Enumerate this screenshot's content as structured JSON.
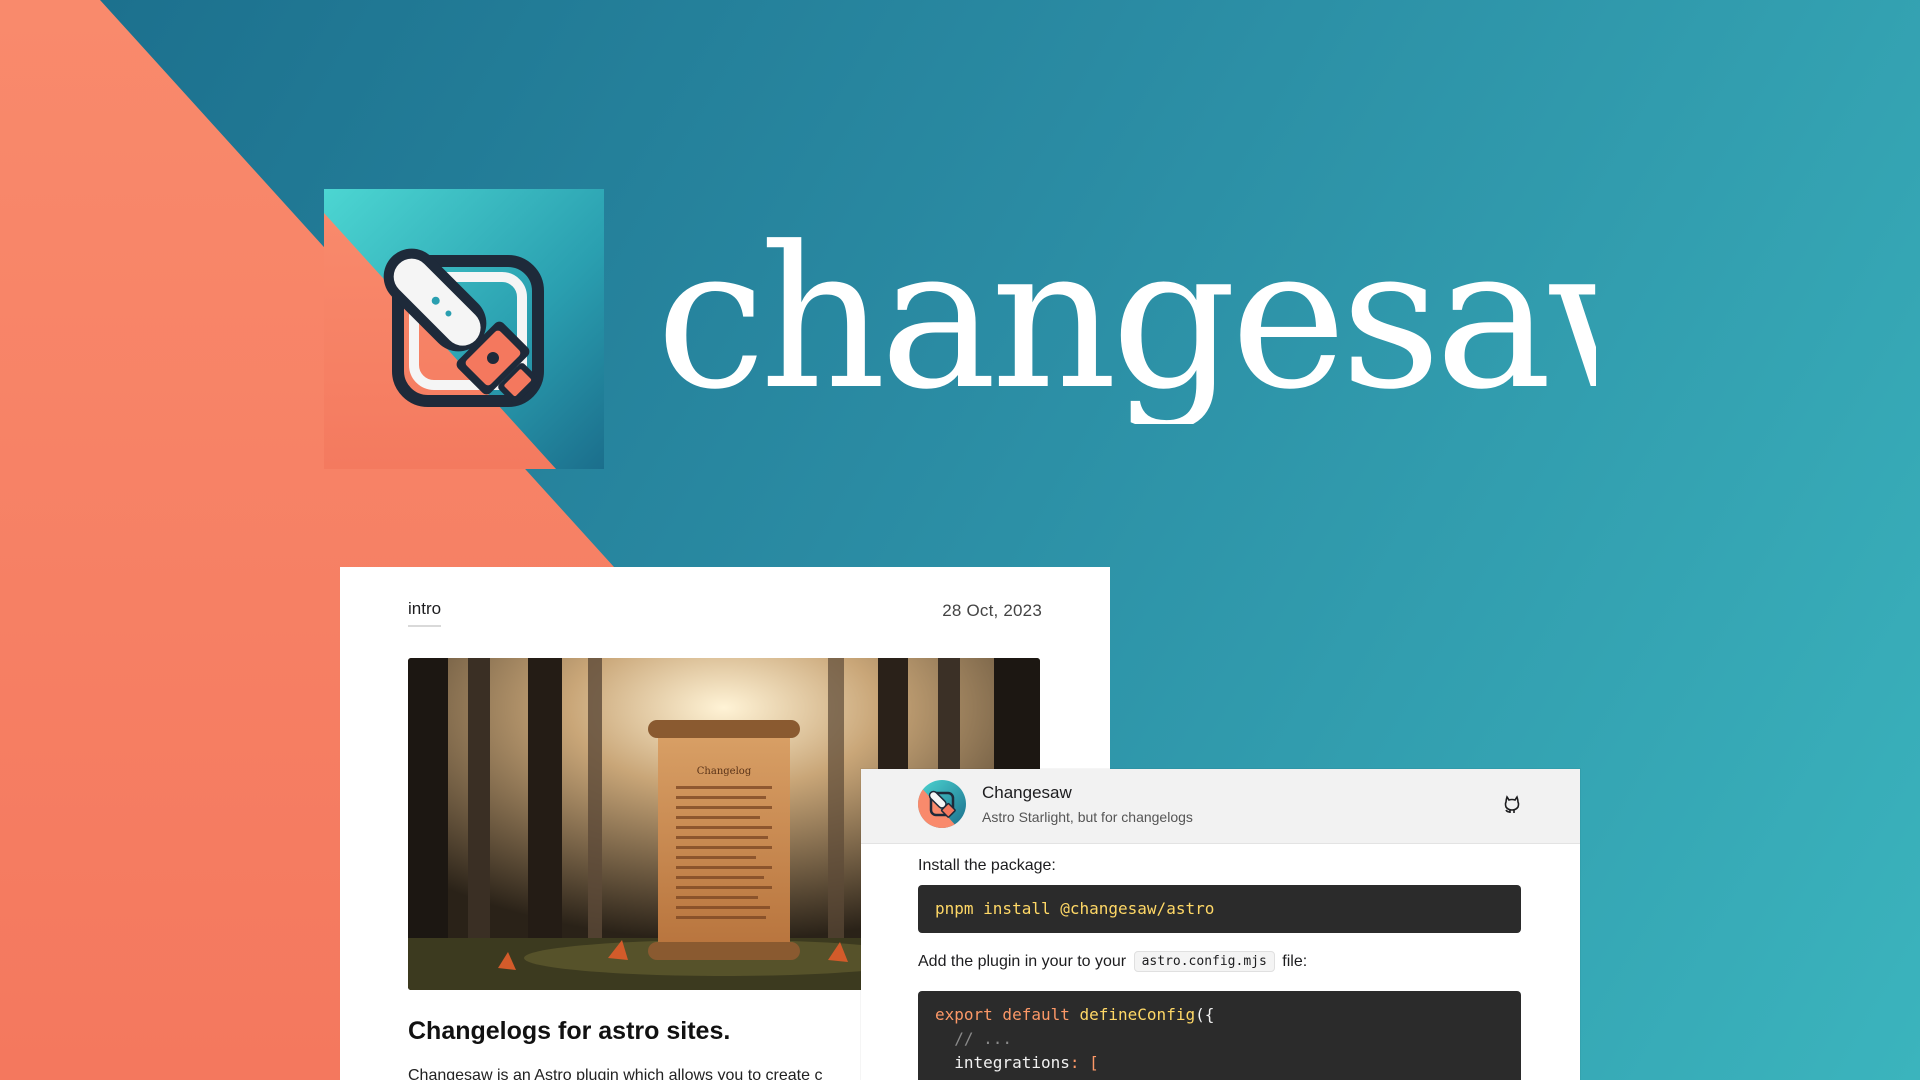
{
  "colors": {
    "coral": "#f98a6c",
    "teal_dark": "#1b6e8c",
    "teal_light": "#3bb4bd",
    "navy": "#1e2a3a",
    "code_bg": "#2b2b2b"
  },
  "brand": {
    "name": "changesaw",
    "logo_icon": "chainsaw-pencil-icon"
  },
  "changelog_card": {
    "tag": "intro",
    "date": "28 Oct, 2023",
    "hero_image": "scroll-in-forest-image",
    "hero_scroll_text": "Changelog",
    "heading": "Changelogs for astro sites.",
    "body": "Changesaw is an Astro plugin which allows you to create c"
  },
  "docs_card": {
    "site_title": "Changesaw",
    "site_subtitle": "Astro Starlight, but for changelogs",
    "github_icon": "github-icon",
    "install_text": "Install the package:",
    "install_code": {
      "cmd": "pnpm",
      "rest": " install @changesaw/astro"
    },
    "plugin_text_before": "Add the plugin in your to your",
    "plugin_file": "astro.config.mjs",
    "plugin_text_after": "file:",
    "config_code": {
      "line1_kw": "export default",
      "line1_fn": " defineConfig",
      "line1_rest": "({",
      "line2": "  // ...",
      "line3_key": "  integrations",
      "line3_rest": ": ["
    }
  }
}
